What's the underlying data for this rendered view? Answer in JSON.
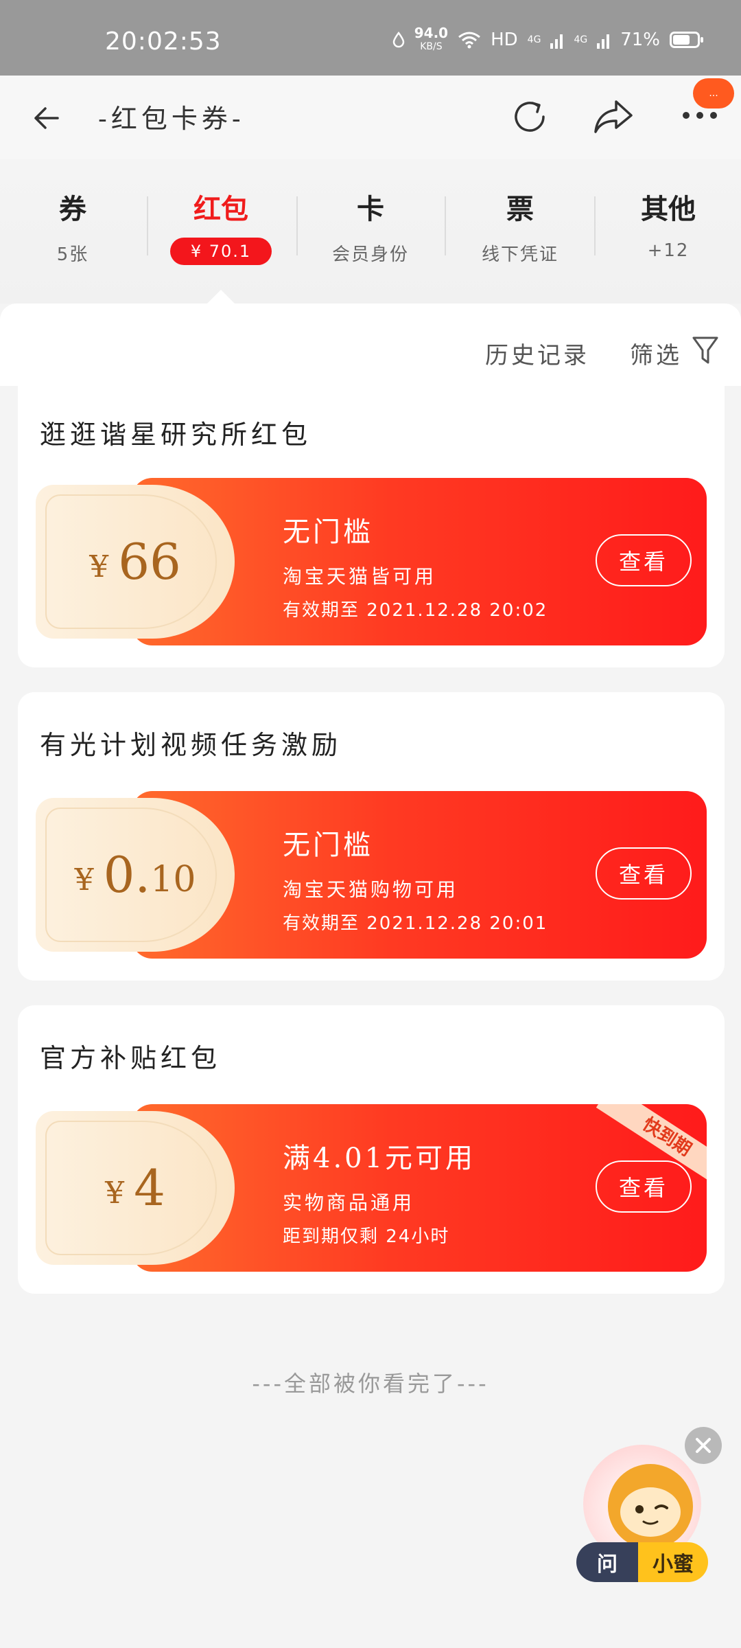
{
  "status_bar": {
    "time": "20:02:53",
    "net_speed": "94.0",
    "net_unit": "KB/S",
    "hd": "HD",
    "signal1": "4G",
    "signal2": "4G",
    "battery": "71%",
    "battery_level": 0.71
  },
  "nav": {
    "title": "-红包卡券-",
    "back_icon": "arrow-left-icon",
    "refresh_icon": "refresh-icon",
    "share_icon": "share-icon",
    "more_icon": "more-dots-icon",
    "badge": "..."
  },
  "tabs": [
    {
      "label": "券",
      "sub": "5张"
    },
    {
      "label": "红包",
      "sub": "¥ 70.1"
    },
    {
      "label": "卡",
      "sub": "会员身份"
    },
    {
      "label": "票",
      "sub": "线下凭证"
    },
    {
      "label": "其他",
      "sub": "+12"
    }
  ],
  "toolbar": {
    "history": "历史记录",
    "filter": "筛选"
  },
  "cards": [
    {
      "title": "逛逛谐星研究所红包",
      "currency": "¥",
      "amount_int": "66",
      "amount_dec": "",
      "coupon_title": "无门槛",
      "line1": "淘宝天猫皆可用",
      "line2": "有效期至 2021.12.28 20:02",
      "button": "查看"
    },
    {
      "title": "有光计划视频任务激励",
      "currency": "¥",
      "amount_int": "0.",
      "amount_dec": "10",
      "coupon_title": "无门槛",
      "line1": "淘宝天猫购物可用",
      "line2": "有效期至 2021.12.28 20:01",
      "button": "查看"
    },
    {
      "title": "官方补贴红包",
      "currency": "¥",
      "amount_int": "4",
      "amount_dec": "",
      "coupon_title": "满4.01元可用",
      "line1": "实物商品通用",
      "line2": "距到期仅剩 24小时",
      "button": "查看",
      "ribbon": "快到期"
    }
  ],
  "footer": {
    "end_text": "---全部被你看完了---"
  },
  "assistant": {
    "ask": "问",
    "name": "小蜜"
  },
  "colors": {
    "accent_red": "#f01c1c",
    "coupon_gold": "#a8651f",
    "status_bar": "#999999"
  }
}
